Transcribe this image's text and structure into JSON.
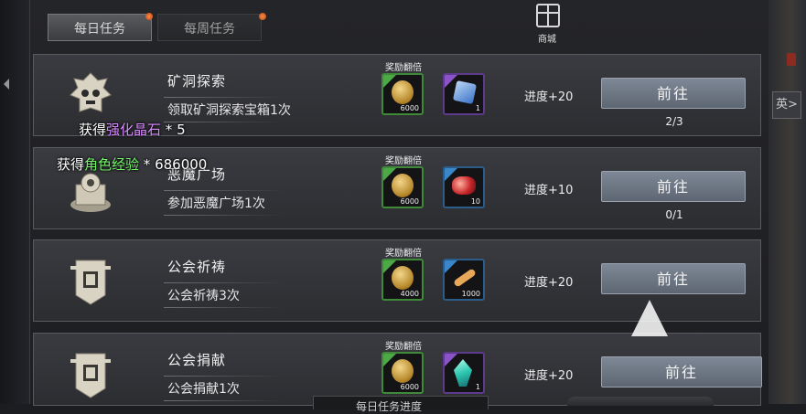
{
  "tabs": [
    {
      "label": "每日任务",
      "active": true
    },
    {
      "label": "每周任务",
      "active": false
    }
  ],
  "shop": {
    "label": "商城",
    "icon": "gift-box-icon"
  },
  "right_panel": {
    "side_tab_label": "英>"
  },
  "tasks": [
    {
      "title": "矿洞探索",
      "desc": "领取矿洞探索宝箱1次",
      "bonus_label": "奖励翻倍",
      "rewards": [
        {
          "icon": "gold-coin-icon",
          "rarity": "green",
          "count": "6000"
        },
        {
          "icon": "blue-die-icon",
          "rarity": "purple",
          "count": "1"
        }
      ],
      "progress": "进度+20",
      "button": "前往",
      "count": "2/3",
      "emblem": "skull-emblem-icon"
    },
    {
      "title": "恶魔广场",
      "desc": "参加恶魔广场1次",
      "bonus_label": "奖励翻倍",
      "rewards": [
        {
          "icon": "gold-coin-icon",
          "rarity": "green",
          "count": "6000"
        },
        {
          "icon": "red-gem-icon",
          "rarity": "blue",
          "count": "10"
        }
      ],
      "progress": "进度+10",
      "button": "前往",
      "count": "0/1",
      "emblem": "altar-emblem-icon"
    },
    {
      "title": "公会祈祷",
      "desc": "公会祈祷3次",
      "bonus_label": "奖励翻倍",
      "rewards": [
        {
          "icon": "gold-coin-icon",
          "rarity": "green",
          "count": "4000"
        },
        {
          "icon": "bone-icon",
          "rarity": "blue",
          "count": "1000"
        }
      ],
      "progress": "进度+20",
      "button": "前往",
      "count": "",
      "emblem": "guild-banner-icon"
    },
    {
      "title": "公会捐献",
      "desc": "公会捐献1次",
      "bonus_label": "奖励翻倍",
      "rewards": [
        {
          "icon": "gold-coin-icon",
          "rarity": "green",
          "count": "6000"
        },
        {
          "icon": "cyan-crystal-icon",
          "rarity": "purple",
          "count": "1"
        }
      ],
      "progress": "进度+20",
      "button": "前往",
      "count": "",
      "emblem": "guild-banner-icon"
    }
  ],
  "floating_texts": [
    {
      "prefix": "获得",
      "highlight": "强化晶石",
      "suffix": " * 5",
      "color": "#d78bff"
    },
    {
      "prefix": "获得",
      "highlight": "角色经验",
      "suffix": " * 686000",
      "color": "#74f36a"
    }
  ],
  "bottom_bar": {
    "label": "每日任务进度"
  }
}
